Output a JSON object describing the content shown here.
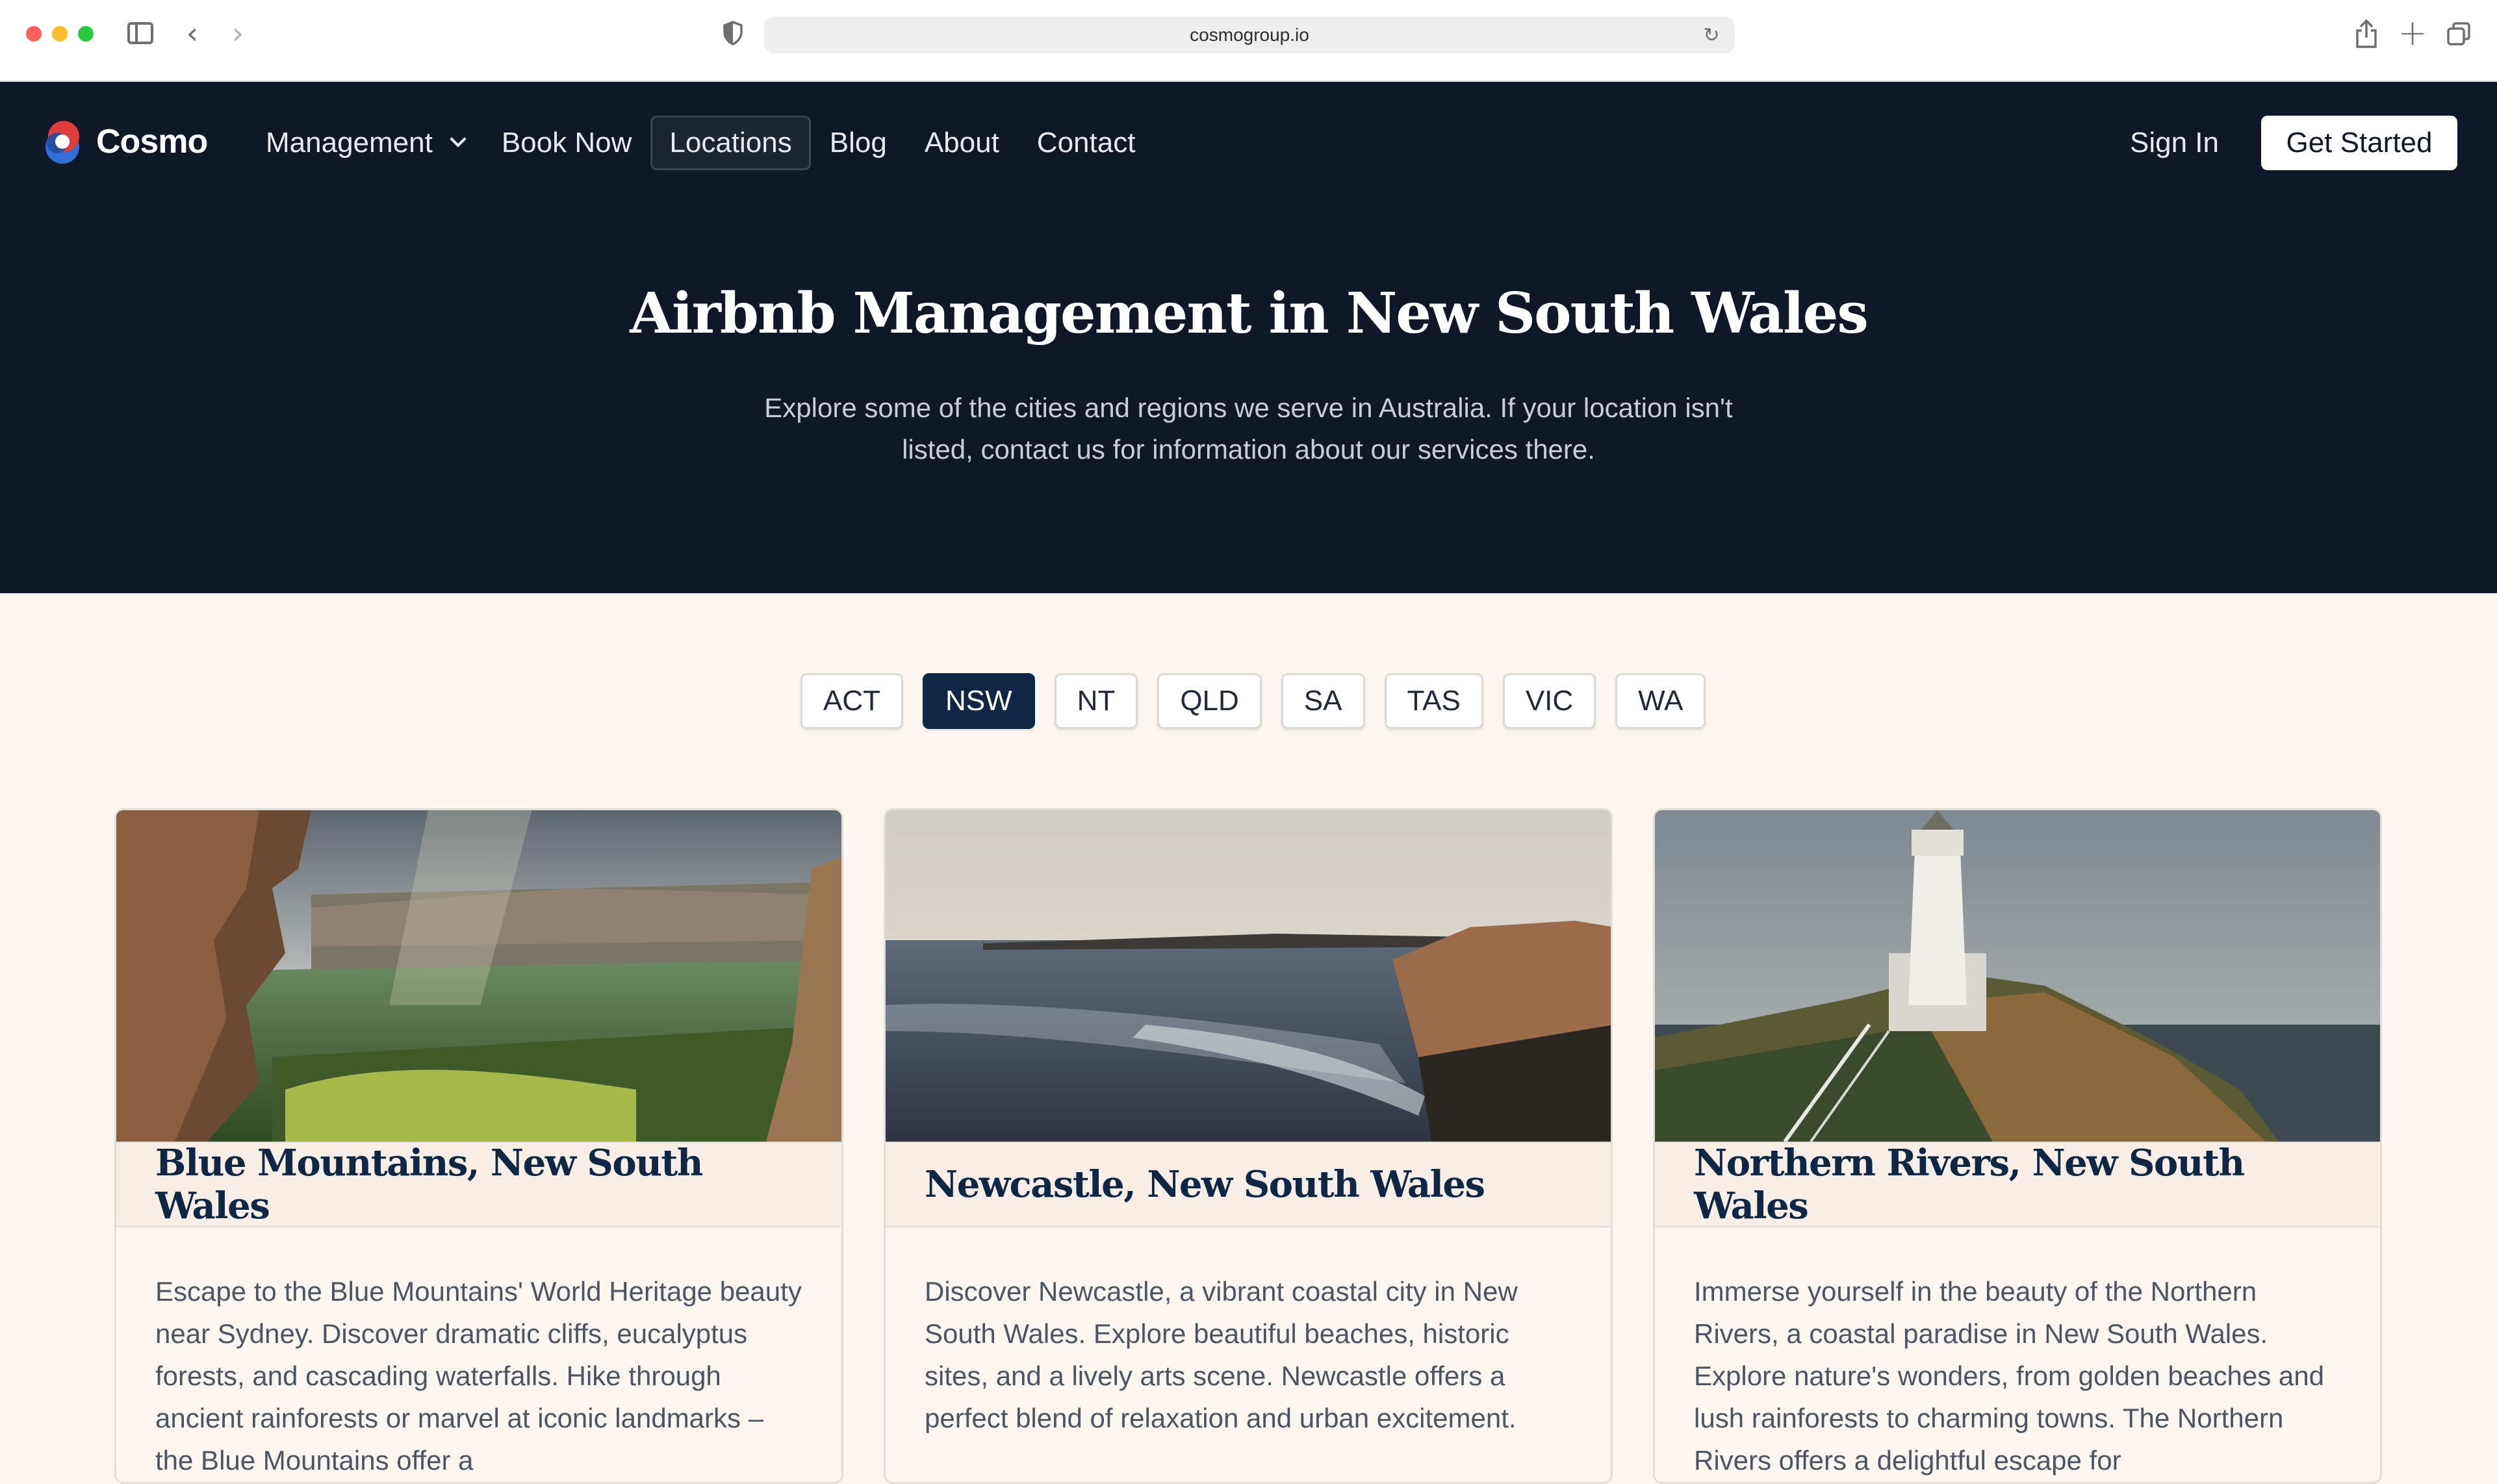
{
  "browser": {
    "url": "cosmogroup.io",
    "icons": [
      "sidebar-icon",
      "back-icon",
      "forward-icon",
      "shield-icon",
      "reload-icon",
      "share-icon",
      "new-tab-icon",
      "tabs-overview-icon"
    ]
  },
  "brand": {
    "name": "Cosmo"
  },
  "nav": {
    "items": [
      {
        "label": "Management",
        "has_dropdown": true
      },
      {
        "label": "Book Now"
      },
      {
        "label": "Locations",
        "active": true
      },
      {
        "label": "Blog"
      },
      {
        "label": "About"
      },
      {
        "label": "Contact"
      }
    ],
    "sign_in": "Sign In",
    "cta": "Get Started"
  },
  "hero": {
    "title": "Airbnb Management in New South Wales",
    "subtitle": "Explore some of the cities and regions we serve in Australia. If your location isn't listed, contact us for information about our services there."
  },
  "states": {
    "options": [
      "ACT",
      "NSW",
      "NT",
      "QLD",
      "SA",
      "TAS",
      "VIC",
      "WA"
    ],
    "selected": "NSW"
  },
  "cards": [
    {
      "title": "Blue Mountains, New South Wales",
      "body": "Escape to the Blue Mountains' World Heritage beauty near Sydney. Discover dramatic cliffs, eucalyptus forests, and cascading waterfalls. Hike through ancient rainforests or marvel at iconic landmarks – the Blue Mountains offer a",
      "image": "blue-mountains-photo"
    },
    {
      "title": "Newcastle, New South Wales",
      "body": "Discover Newcastle, a vibrant coastal city in New South Wales. Explore beautiful beaches, historic sites, and a lively arts scene. Newcastle offers a perfect blend of relaxation and urban excitement.",
      "image": "newcastle-coast-photo"
    },
    {
      "title": "Northern Rivers, New South Wales",
      "body": "Immerse yourself in the beauty of the Northern Rivers, a coastal paradise in New South Wales. Explore nature's wonders, from golden beaches and lush rainforests to charming towns. The Northern Rivers offers a delightful escape for",
      "image": "lighthouse-photo"
    }
  ],
  "colors": {
    "header_bg": "#101828",
    "page_bg": "#fbf6f0",
    "accent": "#0f2744"
  }
}
